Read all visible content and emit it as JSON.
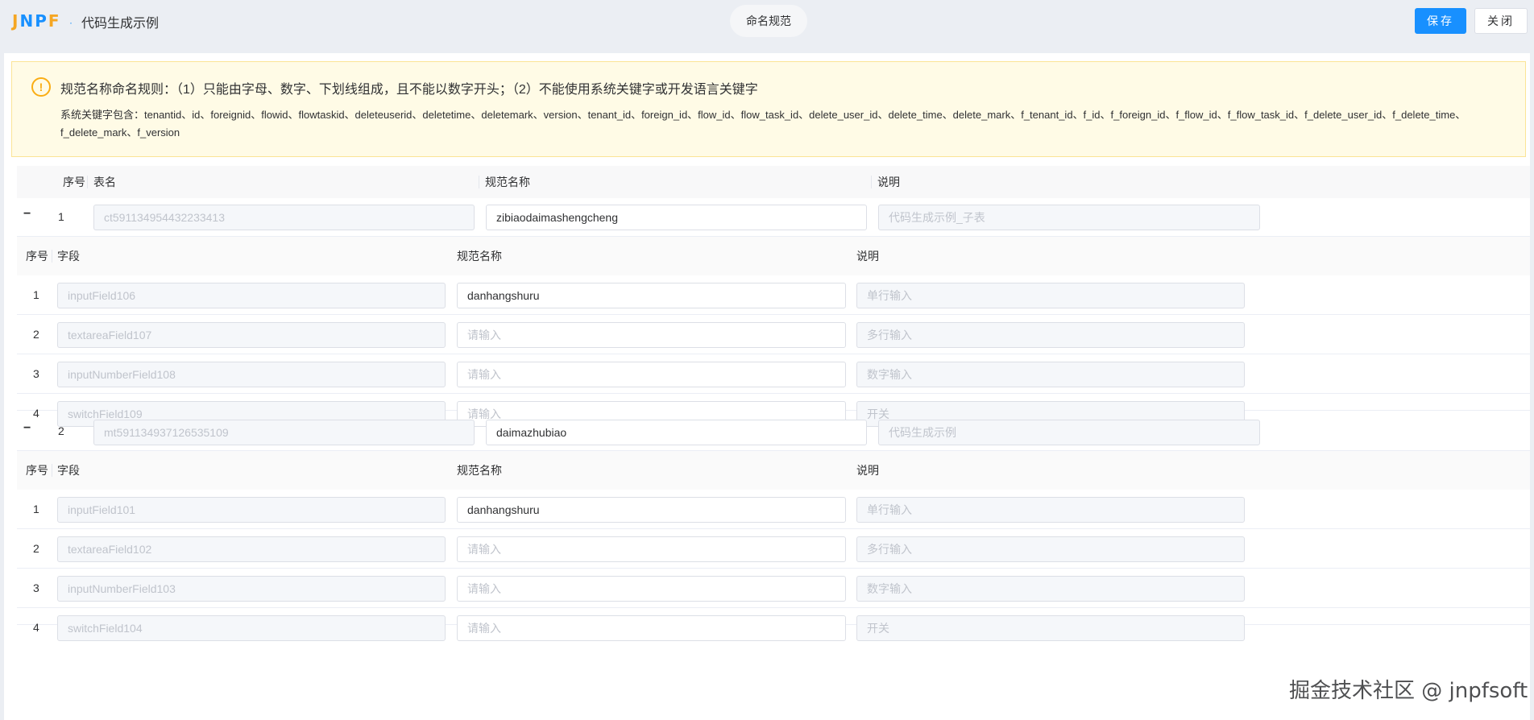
{
  "logo": {
    "text_j": "J",
    "text_n": "N",
    "text_p": "P",
    "text_f": "F"
  },
  "header": {
    "separator": "·",
    "title": "代码生成示例",
    "center_tab": "命名规范",
    "save_label": "保存",
    "close_label": "关闭"
  },
  "alert": {
    "icon": "warning-circle-icon",
    "title": "规范名称命名规则：（1）只能由字母、数字、下划线组成，且不能以数字开头；（2）不能使用系统关键字或开发语言关键字",
    "desc": "系统关键字包含：tenantid、id、foreignid、flowid、flowtaskid、deleteuserid、deletetime、deletemark、version、tenant_id、foreign_id、flow_id、flow_task_id、delete_user_id、delete_time、delete_mark、f_tenant_id、f_id、f_foreign_id、f_flow_id、f_flow_task_id、f_delete_user_id、f_delete_time、f_delete_mark、f_version"
  },
  "outer_table": {
    "columns": {
      "index": "序号",
      "table": "表名",
      "name": "规范名称",
      "desc": "说明"
    },
    "rows": [
      {
        "collapse": "−",
        "index": "1",
        "table": "ct591134954432233413",
        "name": "zibiaodaimashengcheng",
        "desc": "代码生成示例_子表",
        "fields": {
          "columns": {
            "index": "序号",
            "field": "字段",
            "name": "规范名称",
            "desc": "说明"
          },
          "rows": [
            {
              "index": "1",
              "field": "inputField106",
              "name": "danhangshuru",
              "name_placeholder": "",
              "desc": "单行输入"
            },
            {
              "index": "2",
              "field": "textareaField107",
              "name": "",
              "name_placeholder": "请输入",
              "desc": "多行输入"
            },
            {
              "index": "3",
              "field": "inputNumberField108",
              "name": "",
              "name_placeholder": "请输入",
              "desc": "数字输入"
            },
            {
              "index": "4",
              "field": "switchField109",
              "name": "",
              "name_placeholder": "请输入",
              "desc": "开关"
            }
          ]
        }
      },
      {
        "collapse": "−",
        "index": "2",
        "table": "mt591134937126535109",
        "name": "daimazhubiao",
        "desc": "代码生成示例",
        "fields": {
          "columns": {
            "index": "序号",
            "field": "字段",
            "name": "规范名称",
            "desc": "说明"
          },
          "rows": [
            {
              "index": "1",
              "field": "inputField101",
              "name": "danhangshuru",
              "name_placeholder": "",
              "desc": "单行输入"
            },
            {
              "index": "2",
              "field": "textareaField102",
              "name": "",
              "name_placeholder": "请输入",
              "desc": "多行输入"
            },
            {
              "index": "3",
              "field": "inputNumberField103",
              "name": "",
              "name_placeholder": "请输入",
              "desc": "数字输入"
            },
            {
              "index": "4",
              "field": "switchField104",
              "name": "",
              "name_placeholder": "请输入",
              "desc": "开关"
            }
          ]
        }
      }
    ]
  },
  "watermark": "掘金技术社区 @ jnpfsoft"
}
